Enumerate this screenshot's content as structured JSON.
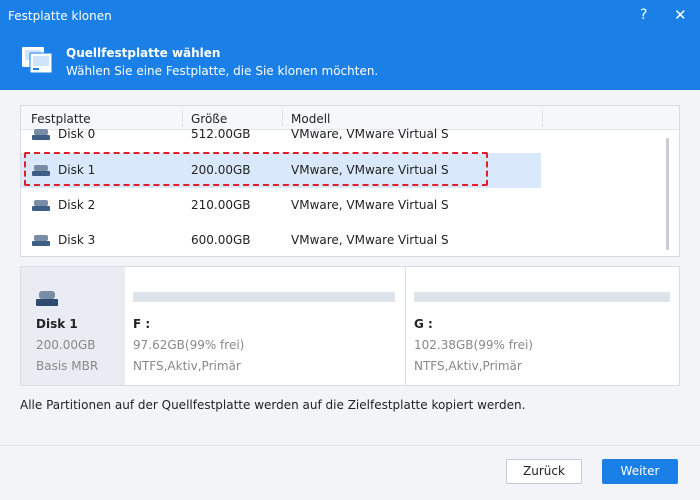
{
  "window": {
    "title": "Festplatte klonen",
    "help_label": "?",
    "close_label": "✕"
  },
  "header": {
    "title": "Quellfestplatte wählen",
    "subtitle": "Wählen Sie eine Festplatte, die Sie klonen möchten."
  },
  "table": {
    "columns": [
      "Festplatte",
      "Größe",
      "Modell"
    ],
    "rows": [
      {
        "name": "Disk 0",
        "size": "512.00GB",
        "model": "VMware, VMware Virtual S"
      },
      {
        "name": "Disk 1",
        "size": "200.00GB",
        "model": "VMware, VMware Virtual S"
      },
      {
        "name": "Disk 2",
        "size": "210.00GB",
        "model": "VMware, VMware Virtual S"
      },
      {
        "name": "Disk 3",
        "size": "600.00GB",
        "model": "VMware, VMware Virtual S"
      }
    ],
    "selected_index": 1
  },
  "detail": {
    "disk_name": "Disk 1",
    "disk_size": "200.00GB",
    "disk_type": "Basis MBR",
    "partitions": [
      {
        "label": "F :",
        "free": "97.62GB(99% frei)",
        "type": "NTFS,Aktiv,Primär"
      },
      {
        "label": "G :",
        "free": "102.38GB(99% frei)",
        "type": "NTFS,Aktiv,Primär"
      }
    ]
  },
  "note": "Alle Partitionen auf der Quellfestplatte werden auf die Zielfestplatte kopiert werden.",
  "buttons": {
    "back": "Zurück",
    "next": "Weiter"
  },
  "colors": {
    "accent": "#1a7fe6",
    "selection": "#d9e9fb",
    "highlight_dashed": "#e0202a"
  }
}
